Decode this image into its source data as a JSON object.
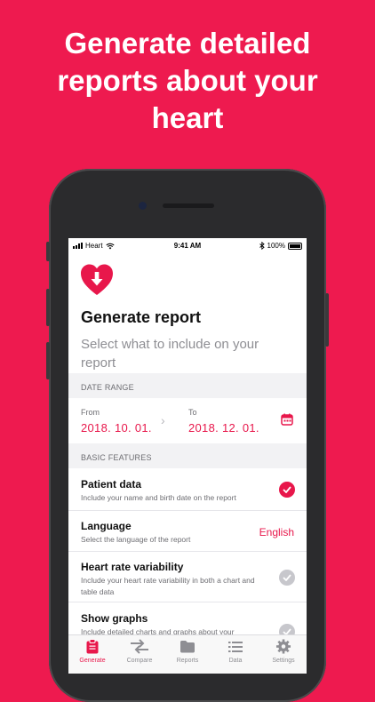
{
  "headline": {
    "line1": "Generate detailed",
    "line2": "reports about your",
    "line3": "heart"
  },
  "status": {
    "carrier": "Heart",
    "time": "9:41 AM",
    "battery": "100%"
  },
  "screen": {
    "title": "Generate report",
    "subtitle": "Select what to include on your report",
    "date_range_header": "DATE RANGE",
    "from_label": "From",
    "from_value": "2018. 10. 01.",
    "to_label": "To",
    "to_value": "2018. 12. 01.",
    "basic_features_header": "BASIC FEATURES",
    "rows": [
      {
        "title": "Patient data",
        "desc": "Include your name and birth date on the report",
        "checked": true
      },
      {
        "title": "Language",
        "desc": "Select the language of the report",
        "value": "English"
      },
      {
        "title": "Heart rate variability",
        "desc": "Include your heart rate variability in both a chart and table data",
        "checked": false
      },
      {
        "title": "Show graphs",
        "desc": "Include detailed charts and graphs about your",
        "checked": false
      }
    ]
  },
  "tabs": [
    {
      "label": "Generate",
      "icon": "clipboard-icon",
      "active": true
    },
    {
      "label": "Compare",
      "icon": "compare-arrows-icon",
      "active": false
    },
    {
      "label": "Reports",
      "icon": "folder-icon",
      "active": false
    },
    {
      "label": "Data",
      "icon": "list-icon",
      "active": false
    },
    {
      "label": "Settings",
      "icon": "gear-icon",
      "active": false
    }
  ],
  "colors": {
    "background": "#ee1a4f",
    "accent": "#e8174b",
    "inactive_check": "#c7c7cc"
  }
}
